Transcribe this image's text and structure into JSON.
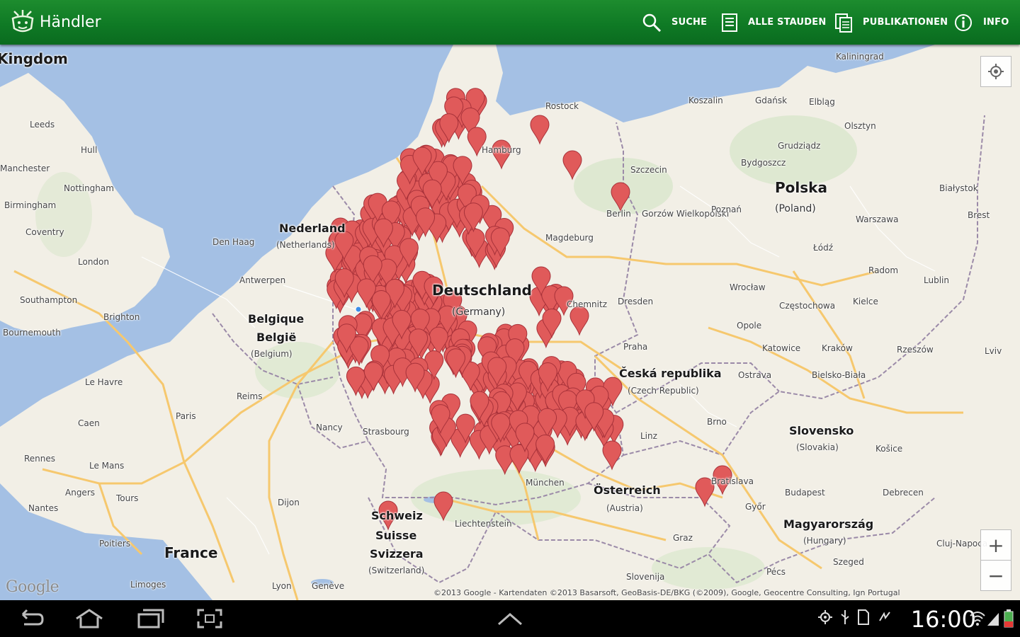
{
  "app": {
    "title": "Händler",
    "actions": [
      {
        "label": "SUCHE",
        "icon": "search-icon"
      },
      {
        "label": "ALLE STAUDEN",
        "icon": "list-icon"
      },
      {
        "label": "PUBLIKATIONEN",
        "icon": "documents-icon"
      },
      {
        "label": "INFO",
        "icon": "info-icon"
      }
    ],
    "accent": "#0f7a25"
  },
  "map": {
    "labels": {
      "kingdom": "Kingdom",
      "nederland": "Nederland",
      "netherlands": "(Netherlands)",
      "belgique": "Belgique",
      "belgie": "België",
      "belgium": "(Belgium)",
      "deutschland": "Deutschland",
      "germany": "(Germany)",
      "polska": "Polska",
      "poland": "(Poland)",
      "ceska": "Česká republika",
      "czech": "(Czech Republic)",
      "slovensko": "Slovensko",
      "slovakia": "(Slovakia)",
      "osterreich": "Österreich",
      "austria": "(Austria)",
      "schweiz": "Schweiz",
      "suisse": "Suisse",
      "svizzera": "Svizzera",
      "switzerland": "(Switzerland)",
      "france": "France",
      "magyar": "Magyarország",
      "hungary": "(Hungary)",
      "liechtenstein": "Liechtenstein",
      "slovenija": "Slovenija",
      "berlin": "Berlin",
      "hamburg": "Hamburg",
      "prague": "Praha",
      "paris": "Paris",
      "london": "London",
      "leeds": "Leeds",
      "hull": "Hull",
      "nottingham": "Nottingham",
      "birmingham": "Birmingham",
      "coventry": "Coventry",
      "manchester": "Manchester",
      "southampton": "Southampton",
      "brighton": "Brighton",
      "bournemouth": "Bournemouth",
      "denhaag": "Den Haag",
      "antwerpen": "Antwerpen",
      "lehavre": "Le Havre",
      "caen": "Caen",
      "rennes": "Rennes",
      "lemans": "Le Mans",
      "angers": "Angers",
      "tours": "Tours",
      "nantes": "Nantes",
      "poitiers": "Poitiers",
      "limoges": "Limoges",
      "lyon": "Lyon",
      "dijon": "Dijon",
      "nancy": "Nancy",
      "reims": "Reims",
      "strasbourg": "Strasbourg",
      "geneve": "Genève",
      "magdeburg": "Magdeburg",
      "dresden": "Dresden",
      "chemnitz": "Chemnitz",
      "rostock": "Rostock",
      "szczecin": "Szczecin",
      "gorzow": "Gorzów Wielkopolski",
      "poznan": "Poznań",
      "warszawa": "Warszawa",
      "lodz": "Łódź",
      "wroclaw": "Wrocław",
      "opole": "Opole",
      "katowice": "Katowice",
      "krakow": "Kraków",
      "czestochowa": "Częstochowa",
      "radom": "Radom",
      "lublin": "Lublin",
      "kielce": "Kielce",
      "rzeszow": "Rzeszów",
      "lviv": "Lviv",
      "bialystok": "Białystok",
      "gdansk": "Gdańsk",
      "koszalin": "Koszalin",
      "elblag": "Elbląg",
      "olsztyn": "Olsztyn",
      "grudziadz": "Grudziądz",
      "bydgoszcz": "Bydgoszcz",
      "kaliningrad": "Kaliningrad",
      "ostrava": "Ostrava",
      "bielsko": "Bielsko-Biała",
      "brno": "Brno",
      "kosice": "Košice",
      "bratislava": "Bratislava",
      "budapest": "Budapest",
      "gyor": "Győr",
      "graz": "Graz",
      "debrecen": "Debrecen",
      "szeged": "Szeged",
      "pecs": "Pécs",
      "clujnapoca": "Cluj-Napoca",
      "munchen": "München",
      "linz": "Linz",
      "brest": "Brest"
    },
    "copyright": "©2013 Google - Kartendaten ©2013 Basarsoft, GeoBasis-DE/BKG (©2009), Google, Geocentre Consulting, Ign Portugal",
    "google_logo": "Google",
    "zoom_in": "+",
    "zoom_out": "−",
    "marker_color": "#e05a5a"
  },
  "status_bar": {
    "time": "16:00"
  }
}
